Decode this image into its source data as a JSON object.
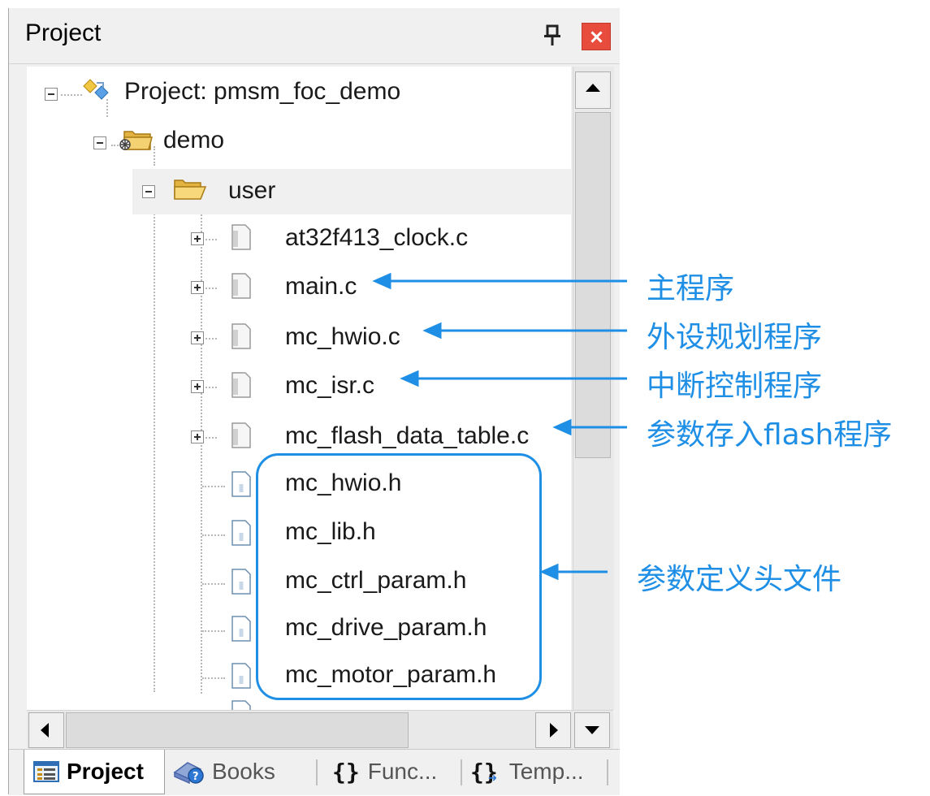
{
  "panel": {
    "title": "Project",
    "pin_icon": "pin-icon",
    "close_icon": "close-icon"
  },
  "tree": {
    "root": {
      "label": "Project: pmsm_foc_demo",
      "icon": "project-icon"
    },
    "group": {
      "label": "demo",
      "icon": "target-folder-icon"
    },
    "folder": {
      "label": "user",
      "icon": "open-folder-icon"
    },
    "source_files": [
      {
        "label": "at32f413_clock.c"
      },
      {
        "label": "main.c"
      },
      {
        "label": "mc_hwio.c"
      },
      {
        "label": "mc_isr.c"
      },
      {
        "label": "mc_flash_data_table.c"
      }
    ],
    "header_files": [
      {
        "label": "mc_hwio.h"
      },
      {
        "label": "mc_lib.h"
      },
      {
        "label": "mc_ctrl_param.h"
      },
      {
        "label": "mc_drive_param.h"
      },
      {
        "label": "mc_motor_param.h"
      }
    ]
  },
  "tabs": [
    {
      "label": "Project",
      "icon": "project-tab-icon",
      "active": true
    },
    {
      "label": "Books",
      "icon": "books-icon",
      "active": false
    },
    {
      "label": "Func...",
      "icon": "functions-braces-icon",
      "active": false
    },
    {
      "label": "Temp...",
      "icon": "templates-icon",
      "active": false
    }
  ],
  "annotations": {
    "main": "主程序",
    "hwio": "外设规划程序",
    "isr": "中断控制程序",
    "flash": "参数存入flash程序",
    "headers": "参数定义头文件"
  },
  "colors": {
    "annotation": "#1f8fe6",
    "close_button": "#e74c3c",
    "panel_bg": "#f0f0f0"
  }
}
